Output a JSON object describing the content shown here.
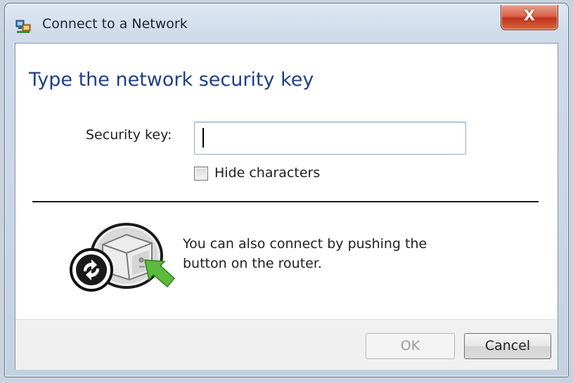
{
  "window": {
    "title": "Connect to a Network",
    "title_icon": "network-connect-icon",
    "close_label": "X",
    "close_icon": "close-icon"
  },
  "main": {
    "heading": "Type the network security key",
    "security_key": {
      "label": "Security key:",
      "value": "",
      "placeholder": ""
    },
    "hide_characters": {
      "label": "Hide characters",
      "checked": false
    },
    "wps": {
      "icon": "router-wps-button-icon",
      "line1": "You can also connect by pushing the",
      "line2": "button on the router."
    }
  },
  "footer": {
    "ok_label": "OK",
    "ok_enabled": false,
    "cancel_label": "Cancel"
  },
  "colors": {
    "heading": "#1e3f8a",
    "arrow": "#5cba3c",
    "close_button": "#c9482f"
  }
}
